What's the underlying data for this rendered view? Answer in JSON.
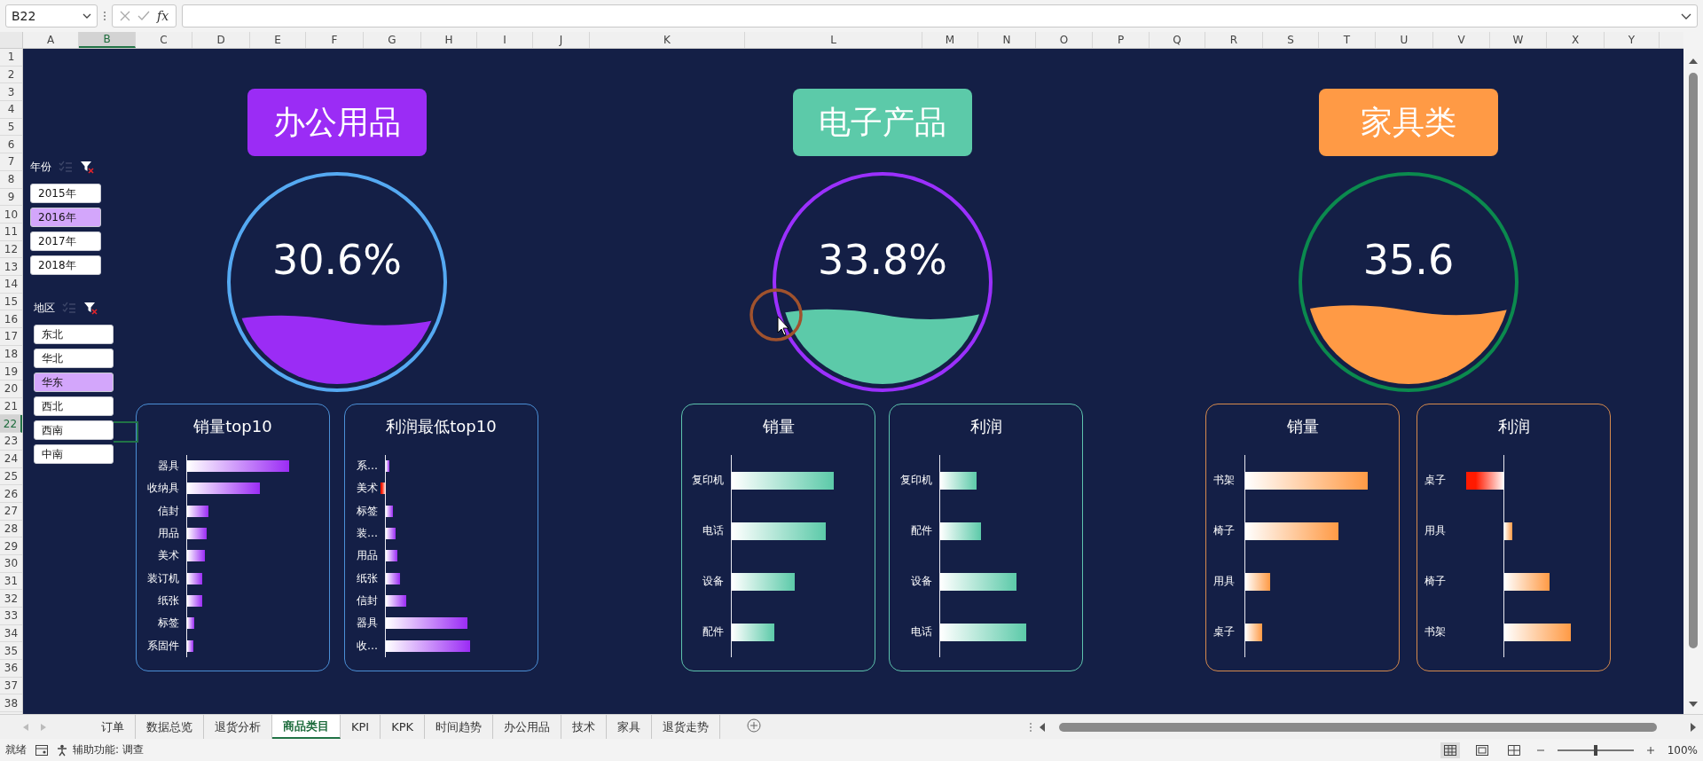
{
  "name_box": {
    "value": "B22"
  },
  "formula_bar": {
    "function_label": "fx"
  },
  "columns": [
    {
      "label": "A",
      "selected": false
    },
    {
      "label": "B",
      "selected": true
    },
    {
      "label": "C",
      "selected": false
    },
    {
      "label": "D",
      "selected": false
    },
    {
      "label": "E",
      "selected": false
    },
    {
      "label": "F",
      "selected": false
    },
    {
      "label": "G",
      "selected": false
    },
    {
      "label": "H",
      "selected": false
    },
    {
      "label": "I",
      "selected": false
    },
    {
      "label": "J",
      "selected": false
    },
    {
      "label": "K",
      "selected": false
    },
    {
      "label": "L",
      "selected": false
    },
    {
      "label": "M",
      "selected": false
    },
    {
      "label": "N",
      "selected": false
    },
    {
      "label": "O",
      "selected": false
    },
    {
      "label": "P",
      "selected": false
    },
    {
      "label": "Q",
      "selected": false
    },
    {
      "label": "R",
      "selected": false
    },
    {
      "label": "S",
      "selected": false
    },
    {
      "label": "T",
      "selected": false
    },
    {
      "label": "U",
      "selected": false
    },
    {
      "label": "V",
      "selected": false
    },
    {
      "label": "W",
      "selected": false
    },
    {
      "label": "X",
      "selected": false
    },
    {
      "label": "Y",
      "selected": false
    }
  ],
  "rows": [
    {
      "label": "1",
      "selected": false
    },
    {
      "label": "2",
      "selected": false
    },
    {
      "label": "3",
      "selected": false
    },
    {
      "label": "4",
      "selected": false
    },
    {
      "label": "5",
      "selected": false
    },
    {
      "label": "6",
      "selected": false
    },
    {
      "label": "7",
      "selected": false
    },
    {
      "label": "8",
      "selected": false
    },
    {
      "label": "9",
      "selected": false
    },
    {
      "label": "10",
      "selected": false
    },
    {
      "label": "11",
      "selected": false
    },
    {
      "label": "12",
      "selected": false
    },
    {
      "label": "13",
      "selected": false
    },
    {
      "label": "14",
      "selected": false
    },
    {
      "label": "15",
      "selected": false
    },
    {
      "label": "16",
      "selected": false
    },
    {
      "label": "17",
      "selected": false
    },
    {
      "label": "18",
      "selected": false
    },
    {
      "label": "19",
      "selected": false
    },
    {
      "label": "20",
      "selected": false
    },
    {
      "label": "21",
      "selected": false
    },
    {
      "label": "22",
      "selected": true
    },
    {
      "label": "23",
      "selected": false
    },
    {
      "label": "24",
      "selected": false
    },
    {
      "label": "25",
      "selected": false
    },
    {
      "label": "26",
      "selected": false
    },
    {
      "label": "27",
      "selected": false
    },
    {
      "label": "28",
      "selected": false
    },
    {
      "label": "29",
      "selected": false
    },
    {
      "label": "30",
      "selected": false
    },
    {
      "label": "31",
      "selected": false
    },
    {
      "label": "32",
      "selected": false
    },
    {
      "label": "33",
      "selected": false
    },
    {
      "label": "34",
      "selected": false
    },
    {
      "label": "35",
      "selected": false
    },
    {
      "label": "36",
      "selected": false
    },
    {
      "label": "37",
      "selected": false
    },
    {
      "label": "38",
      "selected": false
    }
  ],
  "slicers": [
    {
      "title": "年份",
      "items": [
        {
          "label": "2015年",
          "selected": false
        },
        {
          "label": "2016年",
          "selected": true
        },
        {
          "label": "2017年",
          "selected": false
        },
        {
          "label": "2018年",
          "selected": false
        }
      ]
    },
    {
      "title": "地区",
      "items": [
        {
          "label": "东北",
          "selected": false
        },
        {
          "label": "华北",
          "selected": false
        },
        {
          "label": "华东",
          "selected": true
        },
        {
          "label": "西北",
          "selected": false
        },
        {
          "label": "西南",
          "selected": false
        },
        {
          "label": "中南",
          "selected": false
        }
      ]
    }
  ],
  "sections": [
    {
      "title": "办公用品",
      "color": "#9b2cf5",
      "percent": "30.6%",
      "charts": [
        {
          "title": "销量top10",
          "bars": [
            {
              "label": "器具",
              "negative": false
            },
            {
              "label": "收纳具",
              "negative": false
            },
            {
              "label": "信封",
              "negative": false
            },
            {
              "label": "用品",
              "negative": false
            },
            {
              "label": "美术",
              "negative": false
            },
            {
              "label": "装订机",
              "negative": false
            },
            {
              "label": "纸张",
              "negative": false
            },
            {
              "label": "标签",
              "negative": false
            },
            {
              "label": "系固件",
              "negative": false
            }
          ]
        },
        {
          "title": "利润最低top10",
          "bars": [
            {
              "label": "系…",
              "negative": false
            },
            {
              "label": "美术",
              "negative": true
            },
            {
              "label": "标签",
              "negative": false
            },
            {
              "label": "装…",
              "negative": false
            },
            {
              "label": "用品",
              "negative": false
            },
            {
              "label": "纸张",
              "negative": false
            },
            {
              "label": "信封",
              "negative": false
            },
            {
              "label": "器具",
              "negative": false
            },
            {
              "label": "收…",
              "negative": false
            }
          ]
        }
      ]
    },
    {
      "title": "电子产品",
      "color": "#5ccaa9",
      "percent": "33.8%",
      "charts": [
        {
          "title": "销量",
          "bars": [
            {
              "label": "复印机",
              "negative": false
            },
            {
              "label": "电话",
              "negative": false
            },
            {
              "label": "设备",
              "negative": false
            },
            {
              "label": "配件",
              "negative": false
            }
          ]
        },
        {
          "title": "利润",
          "bars": [
            {
              "label": "复印机",
              "negative": false
            },
            {
              "label": "配件",
              "negative": false
            },
            {
              "label": "设备",
              "negative": false
            },
            {
              "label": "电话",
              "negative": false
            }
          ]
        }
      ]
    },
    {
      "title": "家具类",
      "color": "#ff9a45",
      "percent": "35.6",
      "charts": [
        {
          "title": "销量",
          "bars": [
            {
              "label": "书架",
              "negative": false
            },
            {
              "label": "椅子",
              "negative": false
            },
            {
              "label": "用具",
              "negative": false
            },
            {
              "label": "桌子",
              "negative": false
            }
          ]
        },
        {
          "title": "利润",
          "bars": [
            {
              "label": "桌子",
              "negative": true
            },
            {
              "label": "用具",
              "negative": false
            },
            {
              "label": "椅子",
              "negative": false
            },
            {
              "label": "书架",
              "negative": false
            }
          ]
        }
      ]
    }
  ],
  "sheet_tabs": [
    {
      "label": "订单",
      "selected": false
    },
    {
      "label": "数据总览",
      "selected": false
    },
    {
      "label": "退货分析",
      "selected": false
    },
    {
      "label": "商品类目",
      "selected": true
    },
    {
      "label": "KPI",
      "selected": false
    },
    {
      "label": "KPK",
      "selected": false
    },
    {
      "label": "时间趋势",
      "selected": false
    },
    {
      "label": "办公用品",
      "selected": false
    },
    {
      "label": "技术",
      "selected": false
    },
    {
      "label": "家具",
      "selected": false
    },
    {
      "label": "退货走势",
      "selected": false
    }
  ],
  "status_bar": {
    "status": "就绪",
    "accessibility": "辅助功能: 调查",
    "zoom": {
      "reading": "100%",
      "level": 0.5
    }
  }
}
